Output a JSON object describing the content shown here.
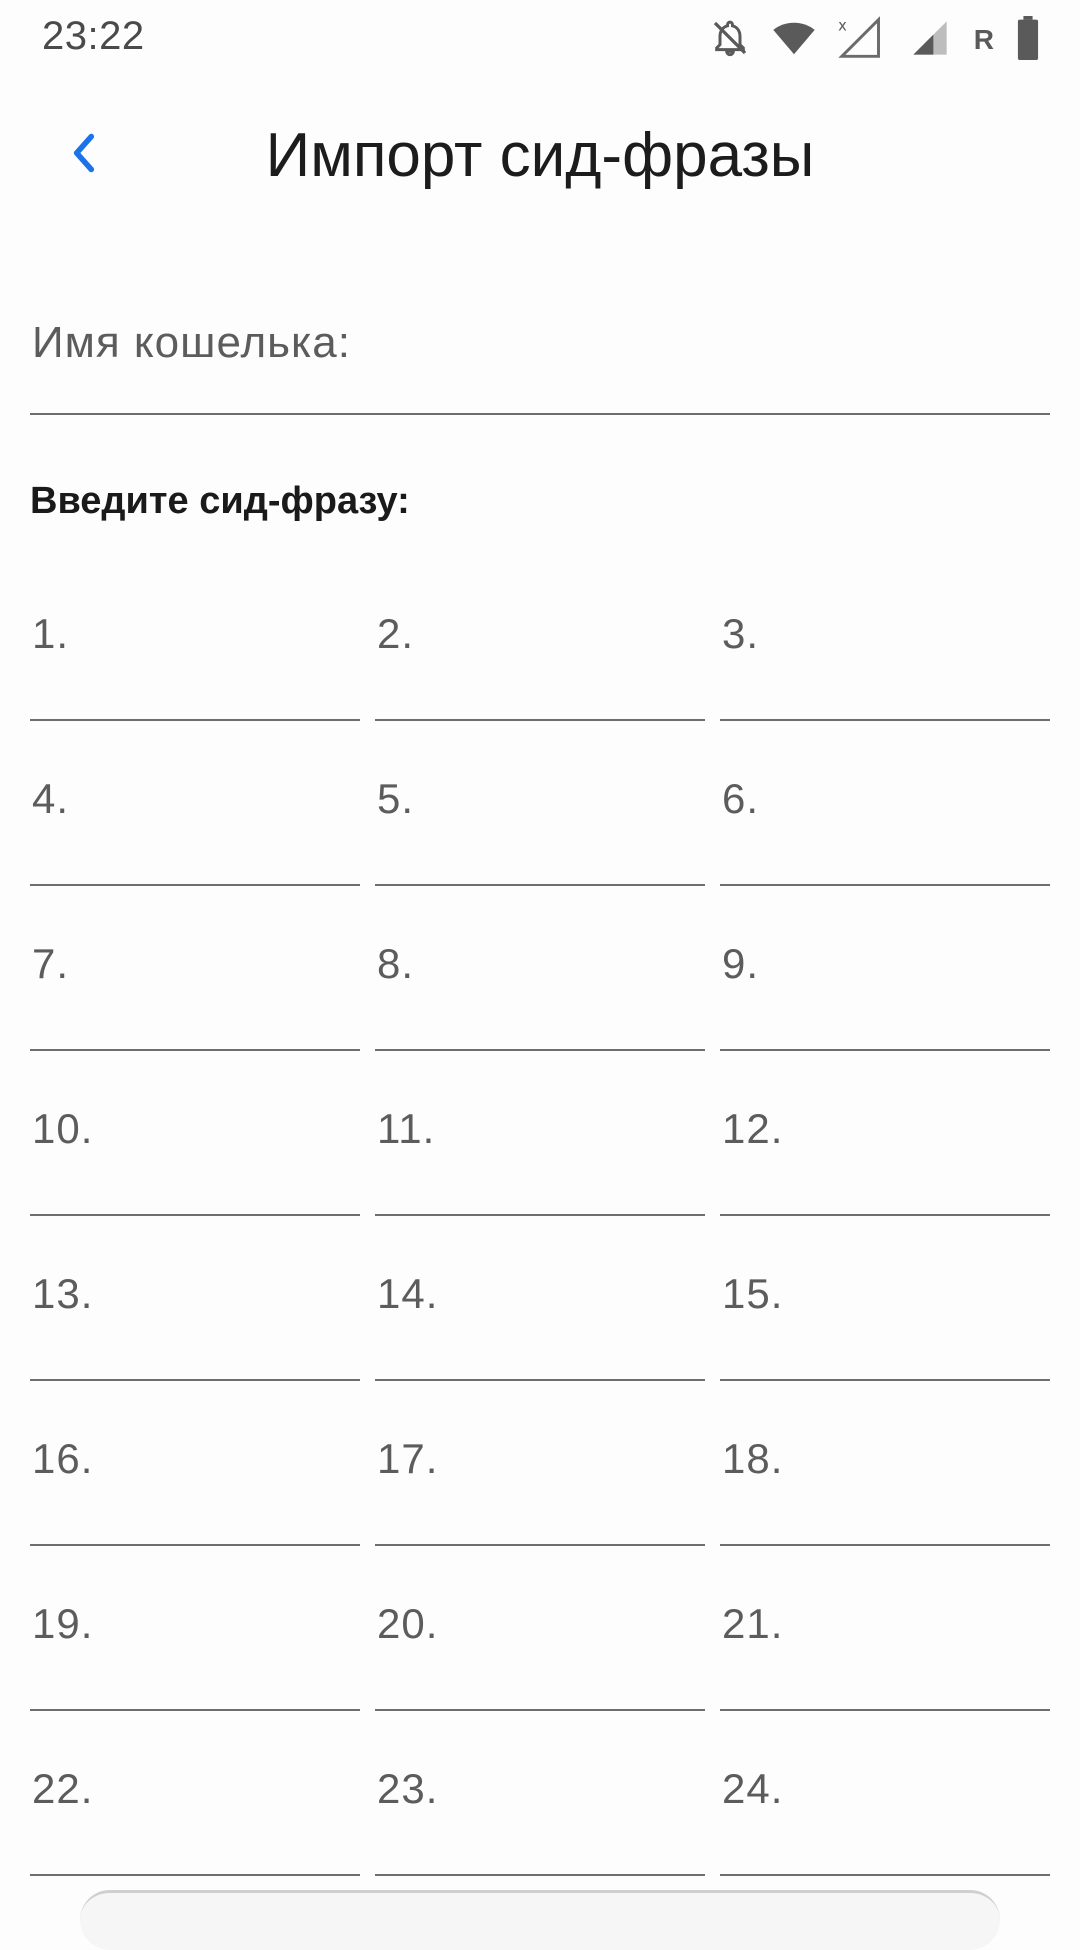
{
  "status_bar": {
    "time": "23:22",
    "roaming": "R",
    "icons": [
      "notifications-off-icon",
      "wifi-icon",
      "signal-no-data-icon",
      "signal-icon",
      "battery-icon"
    ]
  },
  "app_bar": {
    "back_icon": "chevron-left-icon",
    "title": "Импорт сид-фразы",
    "accent_color": "#1a73e8"
  },
  "wallet": {
    "label": "Имя кошелька:",
    "value": ""
  },
  "seed": {
    "heading": "Введите сид-фразу:",
    "words": [
      {
        "label": "1.",
        "value": ""
      },
      {
        "label": "2.",
        "value": ""
      },
      {
        "label": "3.",
        "value": ""
      },
      {
        "label": "4.",
        "value": ""
      },
      {
        "label": "5.",
        "value": ""
      },
      {
        "label": "6.",
        "value": ""
      },
      {
        "label": "7.",
        "value": ""
      },
      {
        "label": "8.",
        "value": ""
      },
      {
        "label": "9.",
        "value": ""
      },
      {
        "label": "10.",
        "value": ""
      },
      {
        "label": "11.",
        "value": ""
      },
      {
        "label": "12.",
        "value": ""
      },
      {
        "label": "13.",
        "value": ""
      },
      {
        "label": "14.",
        "value": ""
      },
      {
        "label": "15.",
        "value": ""
      },
      {
        "label": "16.",
        "value": ""
      },
      {
        "label": "17.",
        "value": ""
      },
      {
        "label": "18.",
        "value": ""
      },
      {
        "label": "19.",
        "value": ""
      },
      {
        "label": "20.",
        "value": ""
      },
      {
        "label": "21.",
        "value": ""
      },
      {
        "label": "22.",
        "value": ""
      },
      {
        "label": "23.",
        "value": ""
      },
      {
        "label": "24.",
        "value": ""
      }
    ]
  }
}
